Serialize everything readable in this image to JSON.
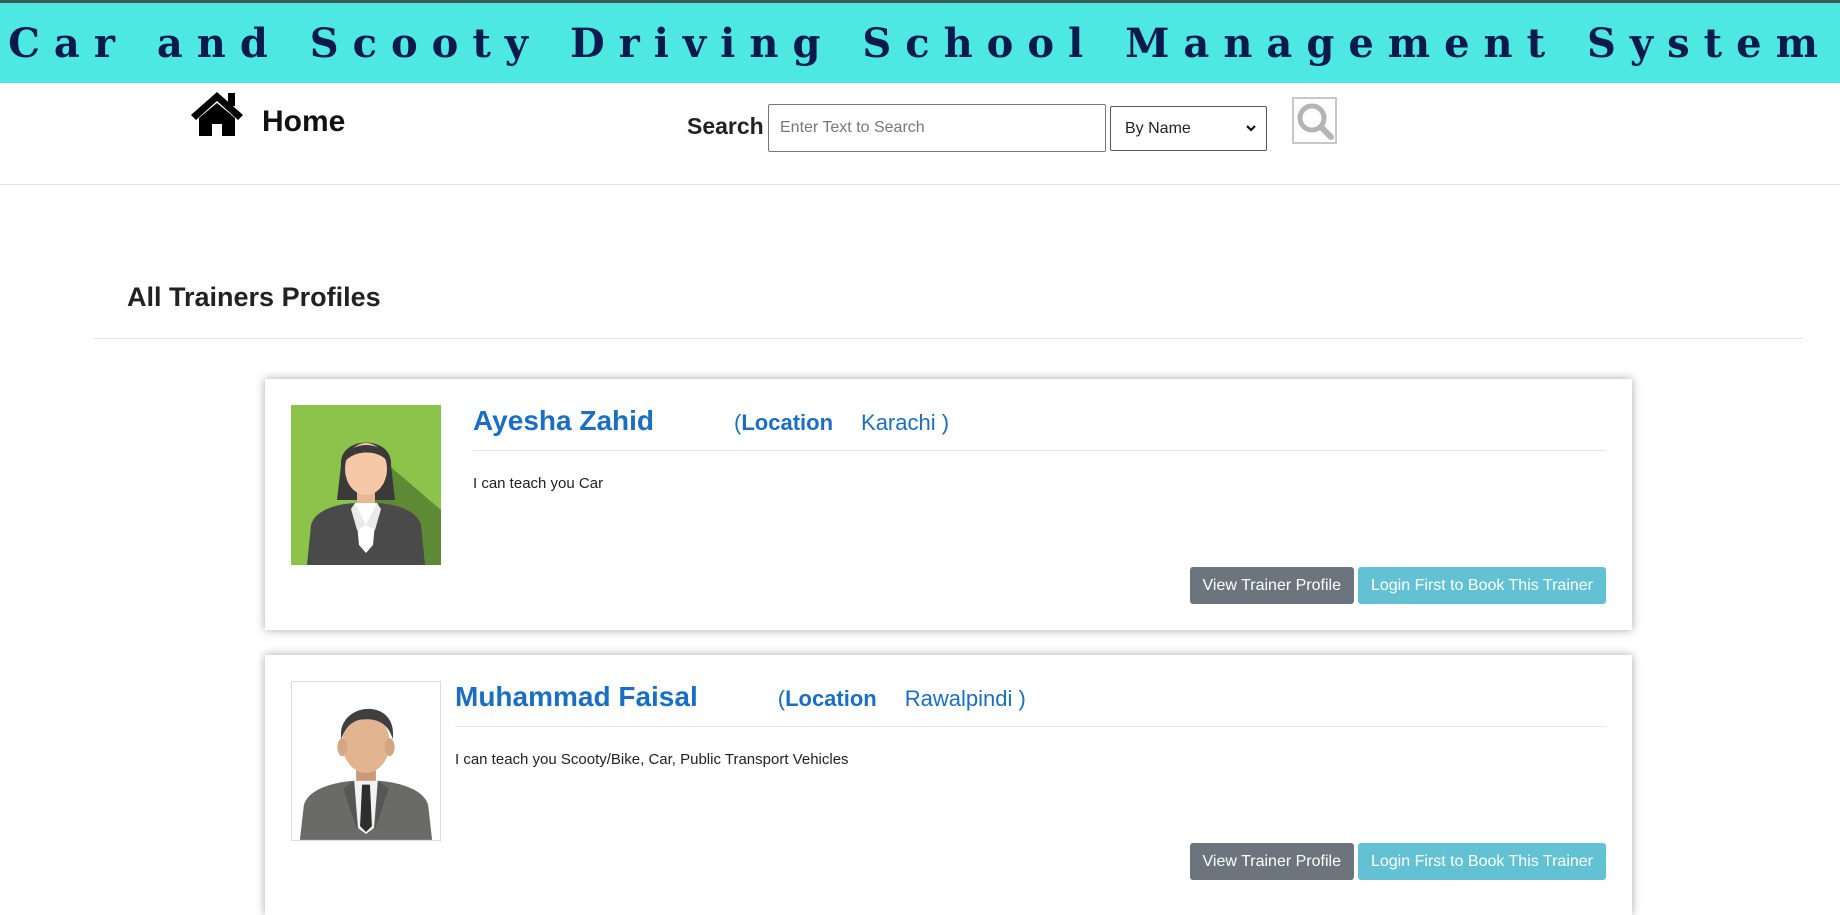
{
  "header": {
    "title": "Car and Scooty Driving School Management System"
  },
  "nav": {
    "home_label": "Home",
    "home_icon": "home-icon",
    "search_label": "Search",
    "search_placeholder": "Enter Text to Search",
    "search_value": "",
    "search_by_selected": "By Name",
    "search_button_icon": "search-icon"
  },
  "main": {
    "heading": "All Trainers Profiles",
    "trainers": [
      {
        "name": "Ayesha Zahid",
        "location_open": "(",
        "location_label": "Location",
        "location_city": "Karachi )",
        "description": "I can teach you Car",
        "view_button": "View Trainer Profile",
        "book_button": "Login First to Book This Trainer"
      },
      {
        "name": "Muhammad Faisal",
        "location_open": "(",
        "location_label": "Location",
        "location_city": "Rawalpindi )",
        "description": "I can teach you Scooty/Bike, Car, Public Transport Vehicles",
        "view_button": "View Trainer Profile",
        "book_button": "Login First to Book This Trainer"
      }
    ]
  },
  "colors": {
    "banner": "#4de8e2",
    "banner_text": "#0b1a4d",
    "link_blue": "#1a6fc4",
    "view_button": "#6c757d",
    "book_button": "#62c2d4"
  }
}
